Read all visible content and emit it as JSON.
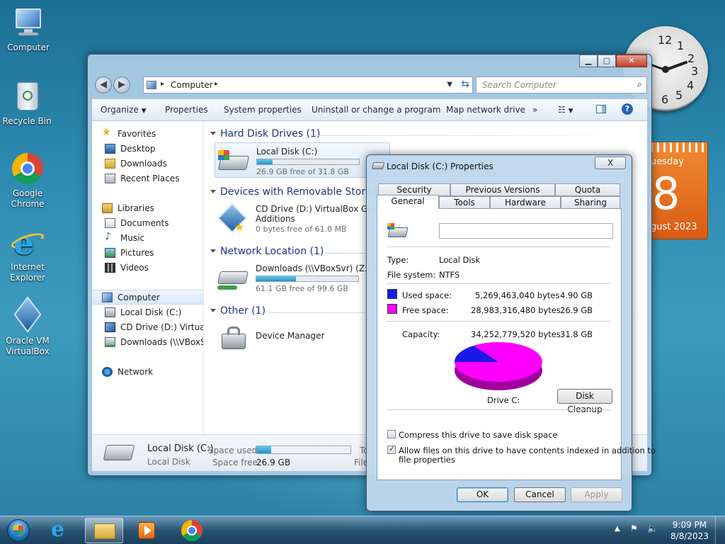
{
  "desktop": {
    "icons": [
      {
        "label": "Computer"
      },
      {
        "label": "Recycle Bin"
      },
      {
        "label": "Google Chrome"
      },
      {
        "label": "Internet Explorer"
      },
      {
        "label": "Oracle VM VirtualBox"
      }
    ],
    "clock_numbers": [
      "12",
      "1",
      "2",
      "3",
      "4",
      "5",
      "6"
    ],
    "calendar": {
      "weekday": "uesday",
      "day": "8",
      "month_year": "gust 2023"
    }
  },
  "explorer": {
    "address": "Computer",
    "search_placeholder": "Search Computer",
    "toolbar": [
      "Organize",
      "Properties",
      "System properties",
      "Uninstall or change a program",
      "Map network drive",
      "»"
    ],
    "nav": {
      "favorites": "Favorites",
      "favorites_items": [
        "Desktop",
        "Downloads",
        "Recent Places"
      ],
      "libraries": "Libraries",
      "libraries_items": [
        "Documents",
        "Music",
        "Pictures",
        "Videos"
      ],
      "computer": "Computer",
      "computer_items": [
        "Local Disk (C:)",
        "CD Drive (D:) Virtual",
        "Downloads (\\\\VBoxS"
      ],
      "network": "Network"
    },
    "groups": {
      "hdd": "Hard Disk Drives (1)",
      "removable": "Devices with Removable Storag",
      "network": "Network Location (1)",
      "other": "Other (1)"
    },
    "items": {
      "local_disk": {
        "name": "Local Disk (C:)",
        "free": "26.9 GB free of 31.8 GB",
        "used_fraction": 0.154
      },
      "cd_drive": {
        "name": "CD Drive (D:) VirtualBox Guest",
        "name2": "Additions",
        "free": "0 bytes free of 61.0 MB"
      },
      "downloads": {
        "name": "Downloads (\\\\VBoxSvr) (Z:)",
        "free": "61.1 GB free of 99.6 GB",
        "used_fraction": 0.387
      },
      "device_manager": {
        "name": "Device Manager"
      }
    },
    "details": {
      "name": "Local Disk (C:)",
      "type": "Local Disk",
      "space_used_label": "Space used:",
      "space_free_label": "Space free:",
      "space_free": "26.9 GB",
      "used_fraction": 0.154,
      "trunc1": "To",
      "trunc2": "File"
    }
  },
  "dialog": {
    "title": "Local Disk (C:) Properties",
    "close": "X",
    "tabs_top": [
      "Security",
      "Previous Versions",
      "Quota"
    ],
    "tabs_bottom": [
      "General",
      "Tools",
      "Hardware",
      "Sharing"
    ],
    "volume_label_value": "",
    "type_label": "Type:",
    "type_value": "Local Disk",
    "fs_label": "File system:",
    "fs_value": "NTFS",
    "used_label": "Used space:",
    "used_bytes": "5,269,463,040 bytes",
    "used_gb": "4.90 GB",
    "free_label": "Free space:",
    "free_bytes": "28,983,316,480 bytes",
    "free_gb": "26.9 GB",
    "capacity_label": "Capacity:",
    "capacity_bytes": "34,252,779,520 bytes",
    "capacity_gb": "31.8 GB",
    "drive_label": "Drive C:",
    "disk_cleanup": "Disk Cleanup",
    "compress_label": "Compress this drive to save disk space",
    "compress_checked": false,
    "index_label": "Allow files on this drive to have contents indexed in addition to",
    "index_label2": "file properties",
    "index_checked": true,
    "ok": "OK",
    "cancel": "Cancel",
    "apply": "Apply",
    "colors": {
      "used": "#1a1ae6",
      "free": "#ff00ff"
    },
    "pie": {
      "used_fraction": 0.154
    }
  },
  "taskbar": {
    "time": "9:09 PM",
    "date": "8/8/2023"
  }
}
